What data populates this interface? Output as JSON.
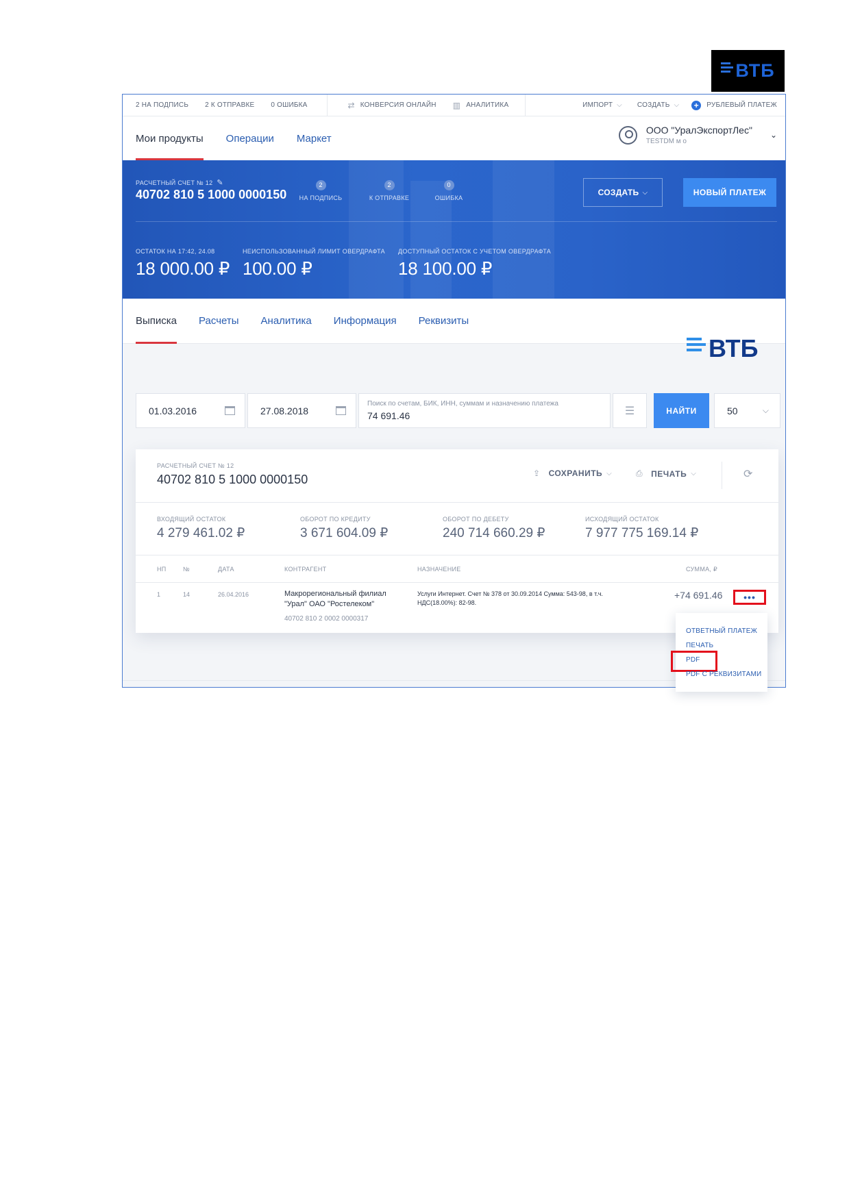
{
  "corner_logo": {
    "text": "ВТБ"
  },
  "topbar": {
    "to_sign": "2 НА ПОДПИСЬ",
    "to_send": "2 К ОТПРАВКЕ",
    "errors": "0 ОШИБКА",
    "conversion": "КОНВЕРСИЯ ОНЛАЙН",
    "analytics": "АНАЛИТИКА",
    "import": "ИМПОРТ",
    "create": "СОЗДАТЬ",
    "ruble_payment": "РУБЛЕВЫЙ ПЛАТЕЖ"
  },
  "mainnav": {
    "tabs": [
      "Мои продукты",
      "Операции",
      "Маркет"
    ],
    "org_name": "ООО \"УралЭкспортЛес\"",
    "org_user": "TESTDM м о"
  },
  "hero": {
    "account_label": "РАСЧЕТНЫЙ СЧЕТ № 12",
    "account_number": "40702 810 5 1000 0000150",
    "counters": [
      {
        "count": "2",
        "label": "НА ПОДПИСЬ"
      },
      {
        "count": "2",
        "label": "К ОТПРАВКЕ"
      },
      {
        "count": "0",
        "label": "ОШИБКА"
      }
    ],
    "create_button": "СОЗДАТЬ",
    "new_payment_button": "НОВЫЙ ПЛАТЕЖ",
    "balances": [
      {
        "label": "ОСТАТОК НА 17:42, 24.08",
        "amount": "18 000.00 ₽"
      },
      {
        "label": "НЕИСПОЛЬЗОВАННЫЙ ЛИМИТ ОВЕРДРАФТА",
        "amount": "100.00 ₽"
      },
      {
        "label": "ДОСТУПНЫЙ ОСТАТОК С УЧЕТОМ ОВЕРДРАФТА",
        "amount": "18 100.00 ₽"
      }
    ]
  },
  "subnav": {
    "tabs": [
      "Выписка",
      "Расчеты",
      "Аналитика",
      "Информация",
      "Реквизиты"
    ]
  },
  "mid_logo": {
    "text": "ВТБ"
  },
  "filters": {
    "date_from": "01.03.2016",
    "date_to": "27.08.2018",
    "search_placeholder": "Поиск по счетам, БИК, ИНН, суммам и назначению платежа",
    "search_value": "74 691.46",
    "find_button": "НАЙТИ",
    "per_page": "50"
  },
  "statement": {
    "account_label": "РАСЧЕТНЫЙ СЧЕТ № 12",
    "account_number": "40702 810 5 1000 0000150",
    "save": "СОХРАНИТЬ",
    "print": "ПЕЧАТЬ",
    "summary": [
      {
        "label": "ВХОДЯЩИЙ ОСТАТОК",
        "amount": "4 279 461.02 ₽"
      },
      {
        "label": "ОБОРОТ ПО КРЕДИТУ",
        "amount": "3 671 604.09 ₽"
      },
      {
        "label": "ОБОРОТ ПО ДЕБЕТУ",
        "amount": "240 714 660.29 ₽"
      },
      {
        "label": "ИСХОДЯЩИЙ ОСТАТОК",
        "amount": "7 977 775 169.14 ₽"
      }
    ],
    "columns": {
      "np": "НП",
      "no": "№",
      "date": "ДАТА",
      "counterparty": "КОНТРАГЕНТ",
      "purpose": "НАЗНАЧЕНИЕ",
      "amount": "СУММА, ₽"
    },
    "row": {
      "np": "1",
      "no": "14",
      "date": "26.04.2016",
      "counterparty": "Макрорегиональный филиал \"Урал\" ОАО \"Ростелеком\"",
      "counterparty_account": "40702 810 2 0002 0000317",
      "purpose": "Услуги Интернет. Счет № 378 от 30.09.2014 Сумма: 543-98, в т.ч. НДС(18.00%): 82-98.",
      "amount": "+74 691.46",
      "more": "•••"
    }
  },
  "context_menu": {
    "items": [
      "ОТВЕТНЫЙ ПЛАТЕЖ",
      "ПЕЧАТЬ",
      "PDF",
      "PDF С РЕКВИЗИТАМИ"
    ]
  }
}
